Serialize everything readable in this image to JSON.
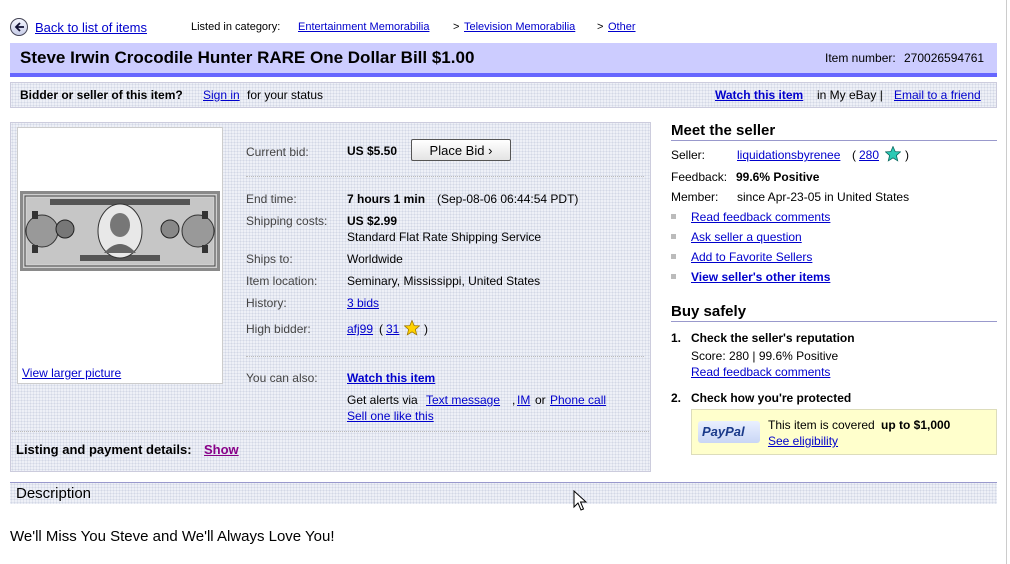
{
  "nav": {
    "back_label": "Back to list of items",
    "listed_in_label": "Listed in category:",
    "categories": [
      "Entertainment Memorabilia",
      "Television Memorabilia",
      "Other"
    ],
    "separator": ">"
  },
  "item": {
    "title": "Steve Irwin Crocodile Hunter RARE One Dollar Bill $1.00",
    "item_number_label": "Item number:",
    "item_number": "270026594761"
  },
  "status": {
    "prompt": "Bidder or seller of this item?",
    "sign_in": "Sign in",
    "suffix": "for your status",
    "watch_link": "Watch this item",
    "in_my_ebay": "in My eBay |",
    "email_link": "Email to a friend"
  },
  "listing": {
    "view_larger": "View larger picture",
    "current_bid_label": "Current bid:",
    "current_bid": "US $5.50",
    "place_bid": "Place Bid",
    "end_time_label": "End time:",
    "end_time": "7 hours 1 min",
    "end_time_detail": "(Sep-08-06 06:44:54 PDT)",
    "shipping_label": "Shipping costs:",
    "shipping_cost": "US $2.99",
    "shipping_service": "Standard Flat Rate Shipping Service",
    "ships_to_label": "Ships to:",
    "ships_to": "Worldwide",
    "location_label": "Item location:",
    "location": "Seminary, Mississippi, United States",
    "history_label": "History:",
    "history": "3 bids",
    "high_bidder_label": "High bidder:",
    "high_bidder": "afj99",
    "high_bidder_score": "31",
    "you_can_also_label": "You can also:",
    "watch_item": "Watch this item",
    "get_alerts": "Get alerts via",
    "text_message": "Text message",
    "im": "IM",
    "or": "or",
    "phone_call": "Phone call",
    "sell_one": "Sell one like this",
    "payment_label": "Listing and payment details:",
    "show": "Show"
  },
  "seller": {
    "heading": "Meet the seller",
    "seller_label": "Seller:",
    "seller_name": "liquidationsbyrenee",
    "seller_score": "280",
    "feedback_label": "Feedback:",
    "feedback": "99.6% Positive",
    "member_label": "Member:",
    "member_since": "since Apr-23-05 in United States",
    "links": [
      "Read feedback comments",
      "Ask seller a question",
      "Add to Favorite Sellers",
      "View seller's other items"
    ]
  },
  "buy_safely": {
    "heading": "Buy safely",
    "step1_num": "1.",
    "step1": "Check the seller's reputation",
    "score_line": "Score: 280 | 99.6% Positive",
    "read_feedback": "Read feedback comments",
    "step2_num": "2.",
    "step2": "Check how you're protected",
    "paypal_logo": "PayPal",
    "covered_text": "This item is covered",
    "covered_amount": "up to $1,000",
    "eligibility": "See eligibility"
  },
  "description": {
    "heading": "Description",
    "text": "We'll Miss You Steve and We'll Always Love You!"
  },
  "icons": {
    "back": "back-arrow-icon",
    "seller_star": "turquoise-star-icon",
    "bidder_star": "yellow-star-icon",
    "cursor": "mouse-pointer-icon"
  },
  "colors": {
    "title_bar": "#ccccff",
    "title_underline": "#6666ff",
    "link": "#0000cc",
    "paypal_box": "#ffffcc"
  }
}
